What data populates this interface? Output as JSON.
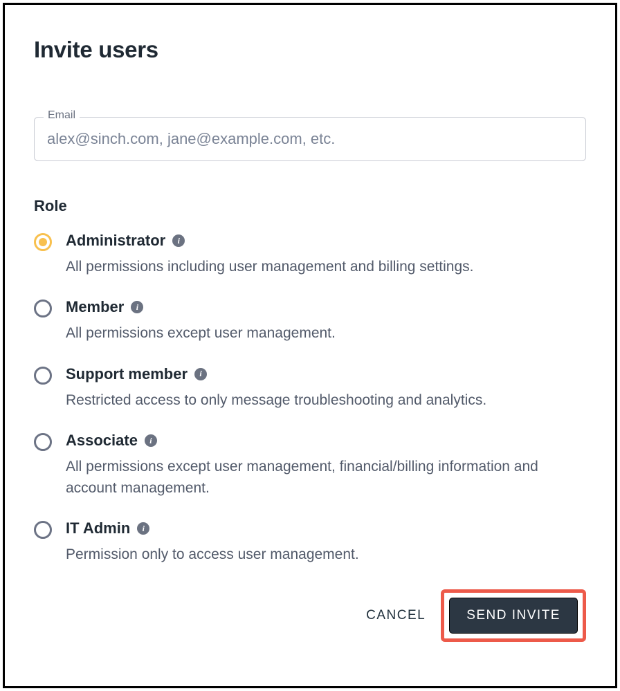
{
  "title": "Invite users",
  "email": {
    "label": "Email",
    "placeholder": "alex@sinch.com, jane@example.com, etc."
  },
  "role_section": {
    "heading": "Role",
    "options": [
      {
        "name": "Administrator",
        "description": "All permissions including user management and billing settings.",
        "selected": true
      },
      {
        "name": "Member",
        "description": "All permissions except user management.",
        "selected": false
      },
      {
        "name": "Support member",
        "description": "Restricted access to only message troubleshooting and analytics.",
        "selected": false
      },
      {
        "name": "Associate",
        "description": "All permissions except user management, financial/billing information and account management.",
        "selected": false
      },
      {
        "name": "IT Admin",
        "description": "Permission only to access user management.",
        "selected": false
      }
    ]
  },
  "actions": {
    "cancel": "CANCEL",
    "send": "SEND INVITE"
  },
  "colors": {
    "accent_radio": "#f8c04e",
    "highlight_border": "#ed5a4a",
    "primary_button_bg": "#2c3743"
  }
}
